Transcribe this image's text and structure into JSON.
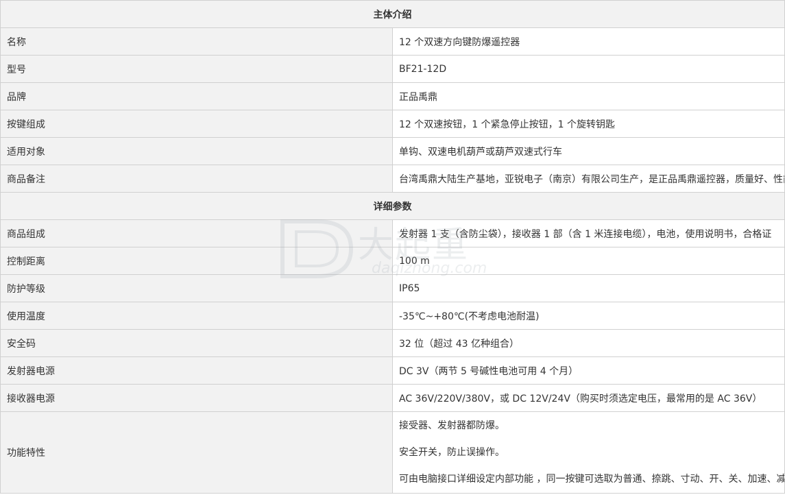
{
  "sections": [
    {
      "title": "主体介绍",
      "rows": [
        {
          "label": "名称",
          "value": "12 个双速方向键防爆遥控器"
        },
        {
          "label": "型号",
          "value": "BF21-12D"
        },
        {
          "label": "品牌",
          "value": "正品禹鼎"
        },
        {
          "label": "按键组成",
          "value": "12 个双速按钮，1 个紧急停止按钮，1 个旋转钥匙"
        },
        {
          "label": "适用对象",
          "value": "单钩、双速电机葫芦或葫芦双速式行车"
        },
        {
          "label": "商品备注",
          "value": "台湾禹鼎大陆生产基地，亚锐电子（南京）有限公司生产，是正品禹鼎遥控器，质量好、性能稳定。"
        }
      ]
    },
    {
      "title": "详细参数",
      "rows": [
        {
          "label": "商品组成",
          "value": "发射器 1 支（含防尘袋），接收器 1 部（含 1 米连接电缆），电池，使用说明书，合格证"
        },
        {
          "label": "控制距离",
          "value": "100 m"
        },
        {
          "label": "防护等级",
          "value": "IP65"
        },
        {
          "label": "使用温度",
          "value": "-35℃~+80℃(不考虑电池耐温)"
        },
        {
          "label": "安全码",
          "value": "32 位（超过 43 亿种组合）"
        },
        {
          "label": "发射器电源",
          "value": "DC 3V（两节 5 号碱性电池可用 4 个月）"
        },
        {
          "label": "接收器电源",
          "value": "AC 36V/220V/380V，或 DC 12V/24V（购买时须选定电压，最常用的是 AC 36V）"
        }
      ],
      "feature_row": {
        "label": "功能特性",
        "lines": [
          "接受器、发射器都防爆。",
          "安全开关，防止误操作。",
          "可由电脑接口详细设定内部功能 ，同一按键可选取为普通、捺跳、寸动、开、关、加速、减速等不同控制功能。"
        ]
      }
    }
  ],
  "watermark": {
    "cn": "大起重",
    "en": "daqizhong.com"
  }
}
